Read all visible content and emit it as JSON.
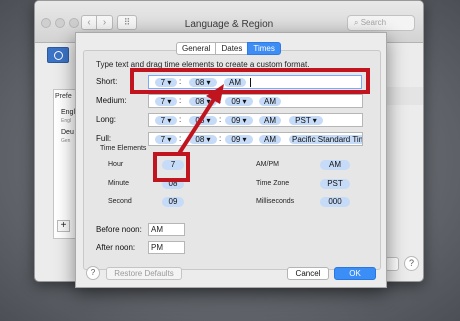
{
  "window": {
    "title": "Language & Region",
    "search_placeholder": "Search",
    "grid_icon": "grid-icon"
  },
  "sidebar": {
    "pref_label": "Prefe",
    "languages": [
      {
        "name": "Engl",
        "sub": "Engl"
      },
      {
        "name": "Deu",
        "sub": "Gen"
      }
    ],
    "add_label": "+"
  },
  "background_help": "?",
  "sheet": {
    "tabs": [
      {
        "label": "General",
        "active": false
      },
      {
        "label": "Dates",
        "active": false
      },
      {
        "label": "Times",
        "active": true
      }
    ],
    "instruction": "Type text and drag time elements to create a custom format.",
    "formats": [
      {
        "label": "Short:",
        "tokens": [
          "7",
          "08",
          "AM"
        ]
      },
      {
        "label": "Medium:",
        "tokens": [
          "7",
          "08",
          "09",
          "AM"
        ]
      },
      {
        "label": "Long:",
        "tokens": [
          "7",
          "08",
          "09",
          "AM",
          "PST"
        ]
      },
      {
        "label": "Full:",
        "tokens": [
          "7",
          "08",
          "09",
          "AM",
          "Pacific Standard Tim"
        ]
      }
    ],
    "time_elements": {
      "title": "Time Elements",
      "items": [
        {
          "label": "Hour",
          "value": "7"
        },
        {
          "label": "AM/PM",
          "value": "AM"
        },
        {
          "label": "Minute",
          "value": "08"
        },
        {
          "label": "Time Zone",
          "value": "PST"
        },
        {
          "label": "Second",
          "value": "09"
        },
        {
          "label": "Milliseconds",
          "value": "000"
        }
      ]
    },
    "before_noon": {
      "label": "Before noon:",
      "value": "AM"
    },
    "after_noon": {
      "label": "After noon:",
      "value": "PM"
    },
    "help": "?",
    "restore_label": "Restore Defaults",
    "cancel_label": "Cancel",
    "ok_label": "OK"
  },
  "colors": {
    "accent": "#3a8ef6",
    "token": "#c6dbf7",
    "annotation_red": "#c0141f"
  }
}
